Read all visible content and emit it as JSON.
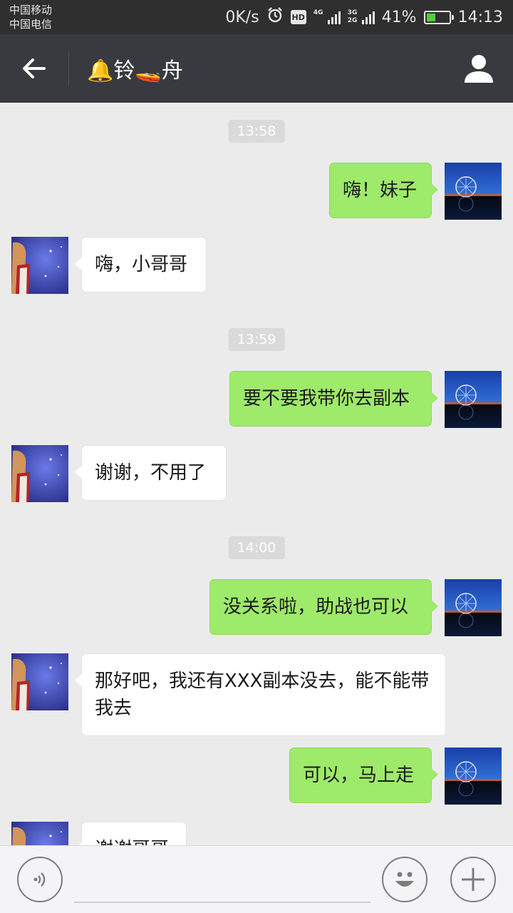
{
  "status_bar": {
    "carrier_1": "中国移动",
    "carrier_2": "中国电信",
    "speed": "0K/s",
    "hd": "HD",
    "net_1": "4G",
    "net_2": "3G\n2G",
    "battery": "41%",
    "battery_level": 0.41,
    "time": "14:13"
  },
  "header": {
    "title": "🔔铃🚤舟",
    "back_icon": "arrow-left-icon",
    "profile_icon": "person-icon"
  },
  "messages": [
    {
      "type": "time",
      "text": "13:58"
    },
    {
      "type": "msg",
      "side": "me",
      "text": "嗨！妹子"
    },
    {
      "type": "msg",
      "side": "them",
      "text": "嗨，小哥哥"
    },
    {
      "type": "time",
      "text": "13:59"
    },
    {
      "type": "msg",
      "side": "me",
      "text": "要不要我带你去副本"
    },
    {
      "type": "msg",
      "side": "them",
      "text": "谢谢，不用了"
    },
    {
      "type": "time",
      "text": "14:00"
    },
    {
      "type": "msg",
      "side": "me",
      "text": "没关系啦，助战也可以"
    },
    {
      "type": "msg",
      "side": "them",
      "text": "那好吧，我还有XXX副本没去，能不能带我去"
    },
    {
      "type": "msg",
      "side": "me",
      "text": "可以，马上走"
    },
    {
      "type": "msg",
      "side": "them",
      "text": "谢谢哥哥"
    }
  ],
  "input_bar": {
    "voice_icon": "voice-icon",
    "emoji_icon": "emoji-icon",
    "plus_icon": "plus-icon"
  },
  "colors": {
    "my_bubble": "#9eea6a",
    "their_bubble": "#ffffff",
    "header_bg": "#393a3f",
    "chat_bg": "#ebebeb"
  }
}
